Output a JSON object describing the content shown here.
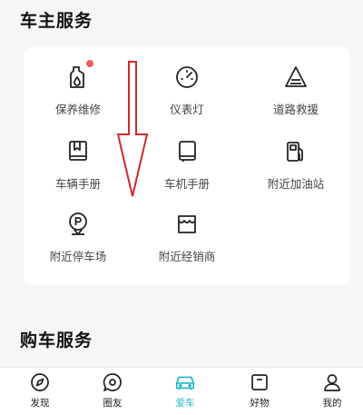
{
  "owner_services": {
    "title": "车主服务",
    "items": [
      {
        "label": "保养维修",
        "icon": "oil-bottle-icon",
        "has_badge": true
      },
      {
        "label": "仪表灯",
        "icon": "gauge-icon"
      },
      {
        "label": "道路救援",
        "icon": "warning-triangle-icon"
      },
      {
        "label": "车辆手册",
        "icon": "book-icon"
      },
      {
        "label": "车机手册",
        "icon": "manual-icon"
      },
      {
        "label": "附近加油站",
        "icon": "fuel-pump-icon"
      },
      {
        "label": "附近停车场",
        "icon": "parking-pin-icon"
      },
      {
        "label": "附近经销商",
        "icon": "store-icon"
      }
    ]
  },
  "purchase_services": {
    "title": "购车服务"
  },
  "tabbar": {
    "active": "爱车",
    "accent_color": "#1fb8c4",
    "tabs": [
      {
        "label": "发现",
        "icon": "compass-icon"
      },
      {
        "label": "圈友",
        "icon": "chat-bubble-icon"
      },
      {
        "label": "爱车",
        "icon": "car-icon"
      },
      {
        "label": "好物",
        "icon": "shopping-bag-icon"
      },
      {
        "label": "我的",
        "icon": "person-icon"
      }
    ]
  }
}
